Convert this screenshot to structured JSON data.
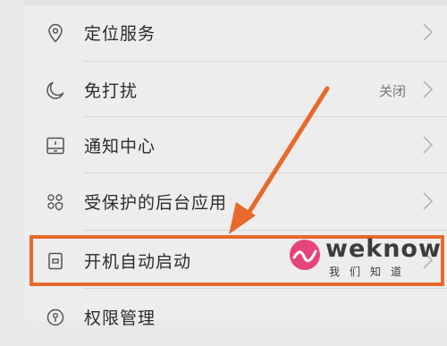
{
  "settings": {
    "items": [
      {
        "label": "定位服务",
        "value": "",
        "icon": "location-icon"
      },
      {
        "label": "免打扰",
        "value": "关闭",
        "icon": "moon-icon"
      },
      {
        "label": "通知中心",
        "value": "",
        "icon": "notification-icon"
      },
      {
        "label": "受保护的后台应用",
        "value": "",
        "icon": "apps-grid-icon"
      },
      {
        "label": "开机自动启动",
        "value": "",
        "icon": "autostart-icon"
      },
      {
        "label": "权限管理",
        "value": "",
        "icon": "permission-icon"
      }
    ]
  },
  "annotation": {
    "color": "#e8692b"
  },
  "watermark": {
    "brand": "weknow",
    "subtitle": "我们知道"
  }
}
